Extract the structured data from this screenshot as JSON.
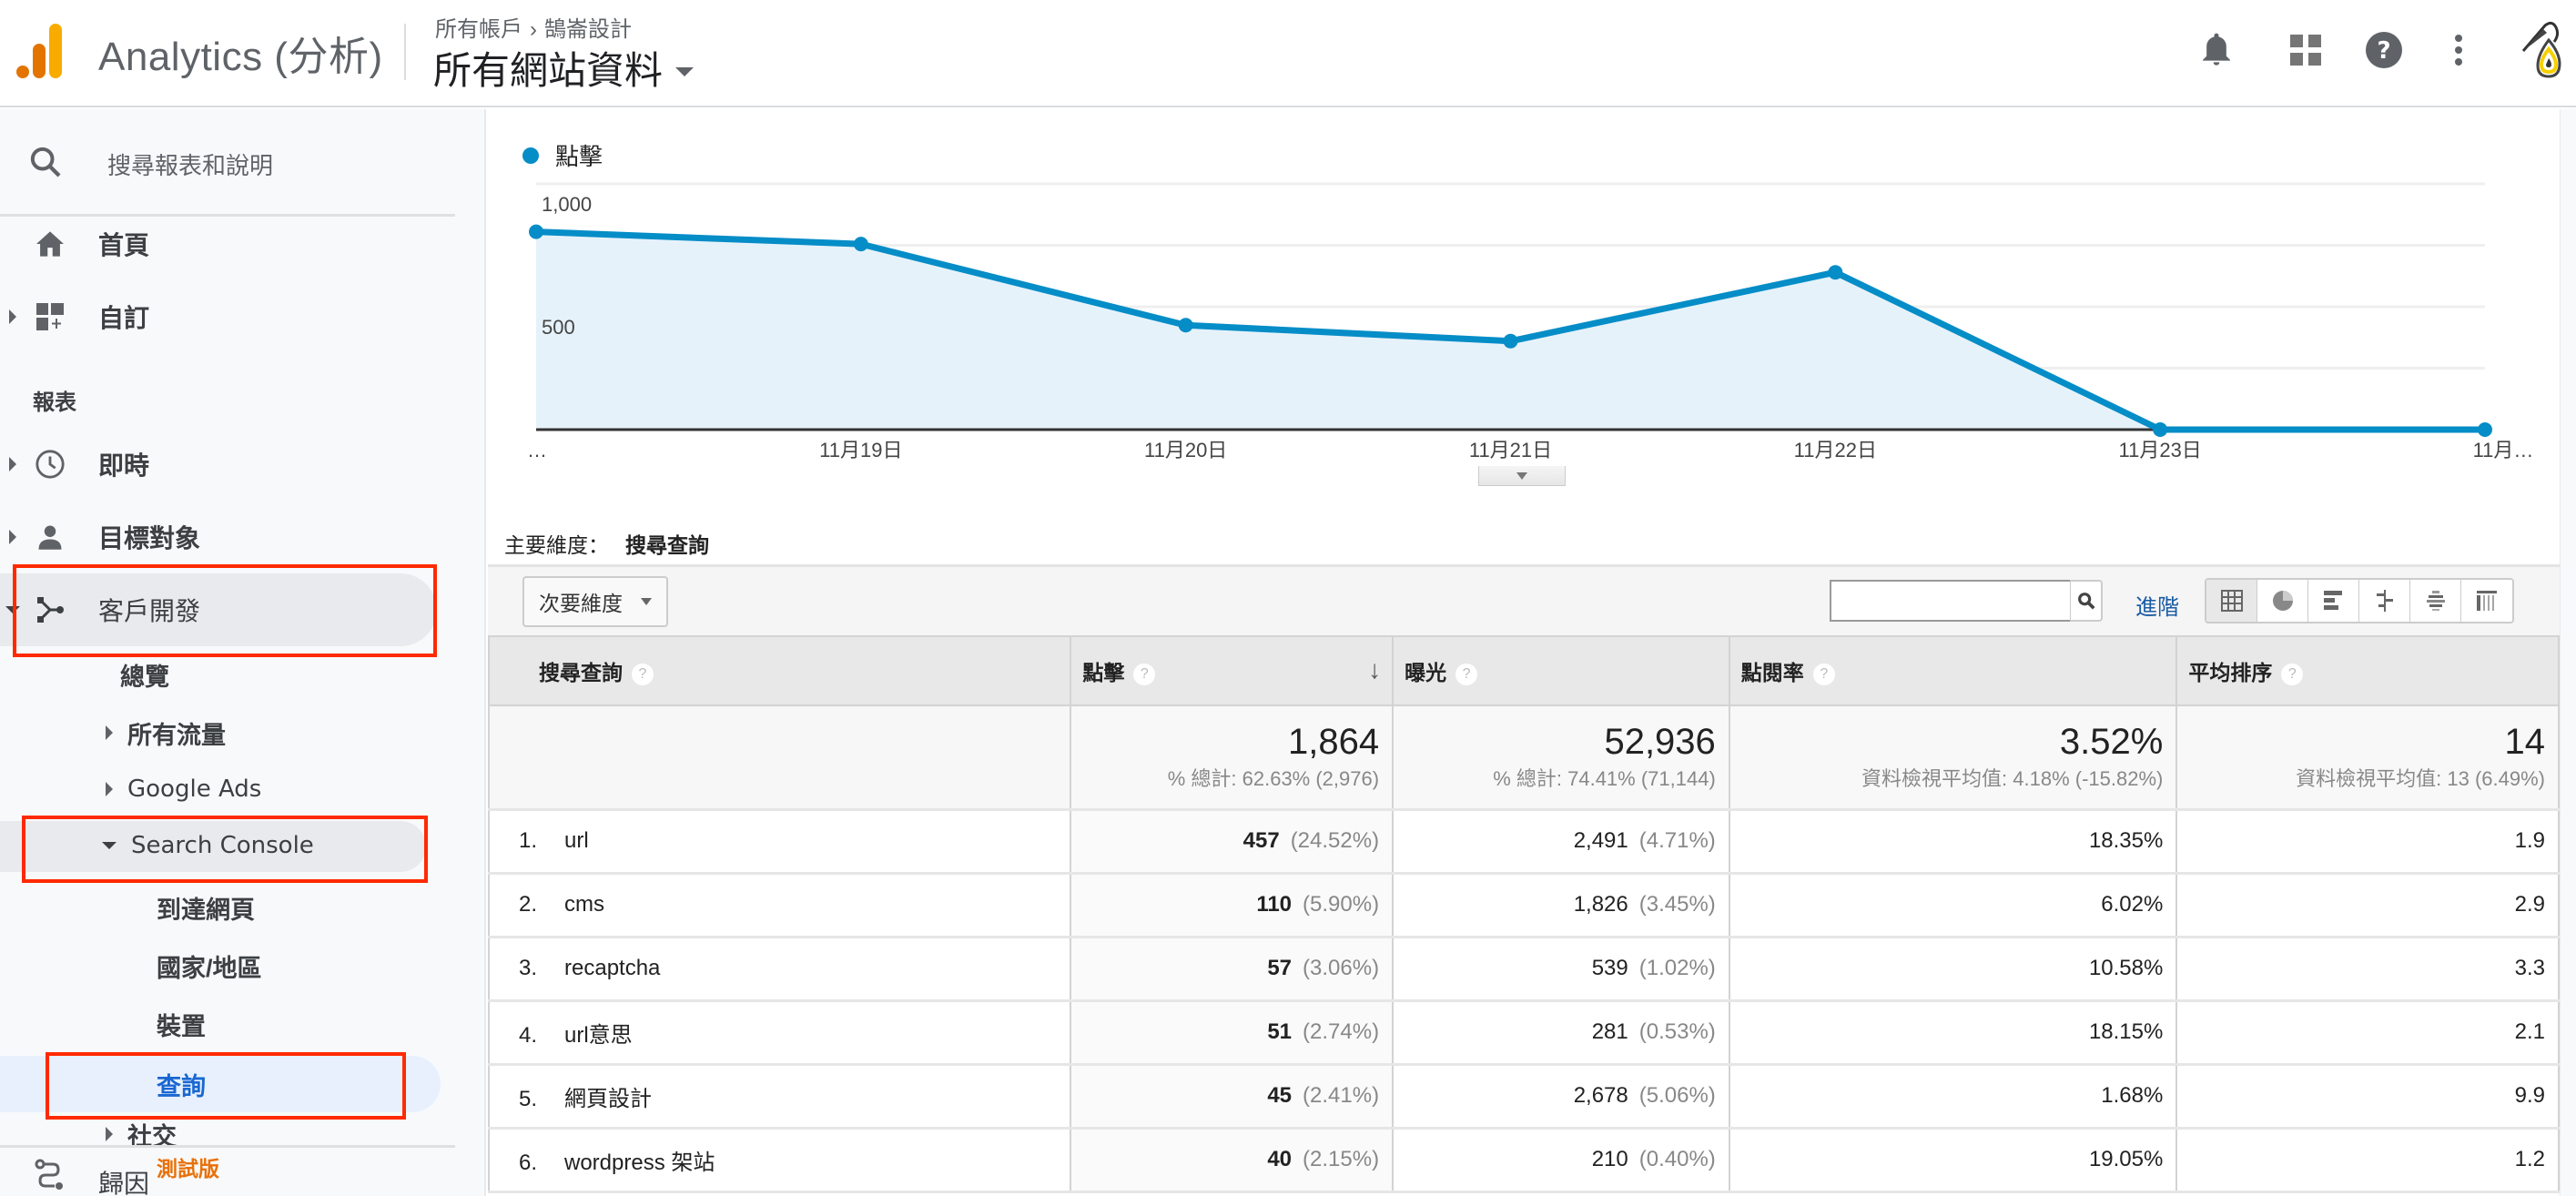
{
  "header": {
    "app_title": "Analytics (分析)",
    "breadcrumb": [
      "所有帳戶",
      "鵠崙設計"
    ],
    "breadcrumb_separator": "›",
    "view_name": "所有網站資料",
    "icons": [
      "notifications-icon",
      "apps-icon",
      "help-icon",
      "more-vert-icon",
      "account-avatar"
    ],
    "logo_colors": [
      "#e37400",
      "#f9ab00"
    ]
  },
  "sidebar": {
    "search_placeholder": "搜尋報表和說明",
    "items": [
      {
        "label": "首頁",
        "icon": "home-icon"
      },
      {
        "label": "自訂",
        "icon": "customization-icon"
      }
    ],
    "section_label": "報表",
    "reports": [
      {
        "label": "即時",
        "icon": "clock-icon"
      },
      {
        "label": "目標對象",
        "icon": "person-icon"
      },
      {
        "label": "客戶開發",
        "icon": "acquisition-icon"
      }
    ],
    "acquisition_children": [
      {
        "label": "總覽"
      },
      {
        "label": "所有流量"
      },
      {
        "label": "Google Ads"
      },
      {
        "label": "Search Console"
      }
    ],
    "search_console_children": [
      {
        "label": "到達網頁"
      },
      {
        "label": "國家/地區"
      },
      {
        "label": "裝置"
      },
      {
        "label": "查詢"
      }
    ],
    "partial_item": "社交",
    "footer": {
      "label": "歸因",
      "badge": "測試版"
    },
    "active_color": "#1967d2",
    "badge_color": "#e8710a"
  },
  "main": {
    "primary_dimension_label": "主要維度：",
    "primary_dimension_value": "搜尋查詢",
    "secondary_dimension_label": "次要維度",
    "search_value": "",
    "advanced_label": "進階",
    "viz_buttons": [
      "table-view",
      "pie-view",
      "performance-view",
      "comparison-view",
      "term-cloud-view",
      "pivot-view"
    ],
    "columns": [
      {
        "label": "搜尋查詢"
      },
      {
        "label": "點擊",
        "sorted": "desc"
      },
      {
        "label": "曝光"
      },
      {
        "label": "點閱率"
      },
      {
        "label": "平均排序"
      }
    ],
    "totals": {
      "clicks": "1,864",
      "clicks_sub": "% 總計: 62.63% (2,976)",
      "impressions": "52,936",
      "impressions_sub": "% 總計: 74.41% (71,144)",
      "ctr": "3.52%",
      "ctr_sub": "資料檢視平均值: 4.18% (-15.82%)",
      "position": "14",
      "position_sub": "資料檢視平均值: 13 (6.49%)"
    },
    "rows": [
      {
        "idx": "1.",
        "query": "url",
        "clicks": "457",
        "clicks_pct": "(24.52%)",
        "impressions": "2,491",
        "impr_pct": "(4.71%)",
        "ctr": "18.35%",
        "position": "1.9"
      },
      {
        "idx": "2.",
        "query": "cms",
        "clicks": "110",
        "clicks_pct": "(5.90%)",
        "impressions": "1,826",
        "impr_pct": "(3.45%)",
        "ctr": "6.02%",
        "position": "2.9"
      },
      {
        "idx": "3.",
        "query": "recaptcha",
        "clicks": "57",
        "clicks_pct": "(3.06%)",
        "impressions": "539",
        "impr_pct": "(1.02%)",
        "ctr": "10.58%",
        "position": "3.3"
      },
      {
        "idx": "4.",
        "query": "url意思",
        "clicks": "51",
        "clicks_pct": "(2.74%)",
        "impressions": "281",
        "impr_pct": "(0.53%)",
        "ctr": "18.15%",
        "position": "2.1"
      },
      {
        "idx": "5.",
        "query": "網頁設計",
        "clicks": "45",
        "clicks_pct": "(2.41%)",
        "impressions": "2,678",
        "impr_pct": "(5.06%)",
        "ctr": "1.68%",
        "position": "9.9"
      },
      {
        "idx": "6.",
        "query": "wordpress 架站",
        "clicks": "40",
        "clicks_pct": "(2.15%)",
        "impressions": "210",
        "impr_pct": "(0.40%)",
        "ctr": "19.05%",
        "position": "1.2"
      }
    ]
  },
  "chart_data": {
    "type": "area",
    "title": "",
    "legend": [
      {
        "name": "點擊",
        "color": "#058dc7"
      }
    ],
    "legend_position": "top-left",
    "x": [
      "…",
      "11月19日",
      "11月20日",
      "11月21日",
      "11月22日",
      "11月23日",
      "11月…"
    ],
    "series": [
      {
        "name": "點擊",
        "values": [
          805,
          755,
          425,
          360,
          640,
          0,
          0
        ]
      }
    ],
    "y_ticks": [
      {
        "value": 1000,
        "label": "1,000"
      },
      {
        "value": 500,
        "label": "500"
      }
    ],
    "gridlines": [
      0,
      250,
      500,
      750,
      1000
    ],
    "ylim": [
      0,
      1000
    ],
    "xlabel": "",
    "ylabel": "",
    "grid": true,
    "line_color": "#058dc7",
    "fill_color": "#e6f2fa"
  }
}
